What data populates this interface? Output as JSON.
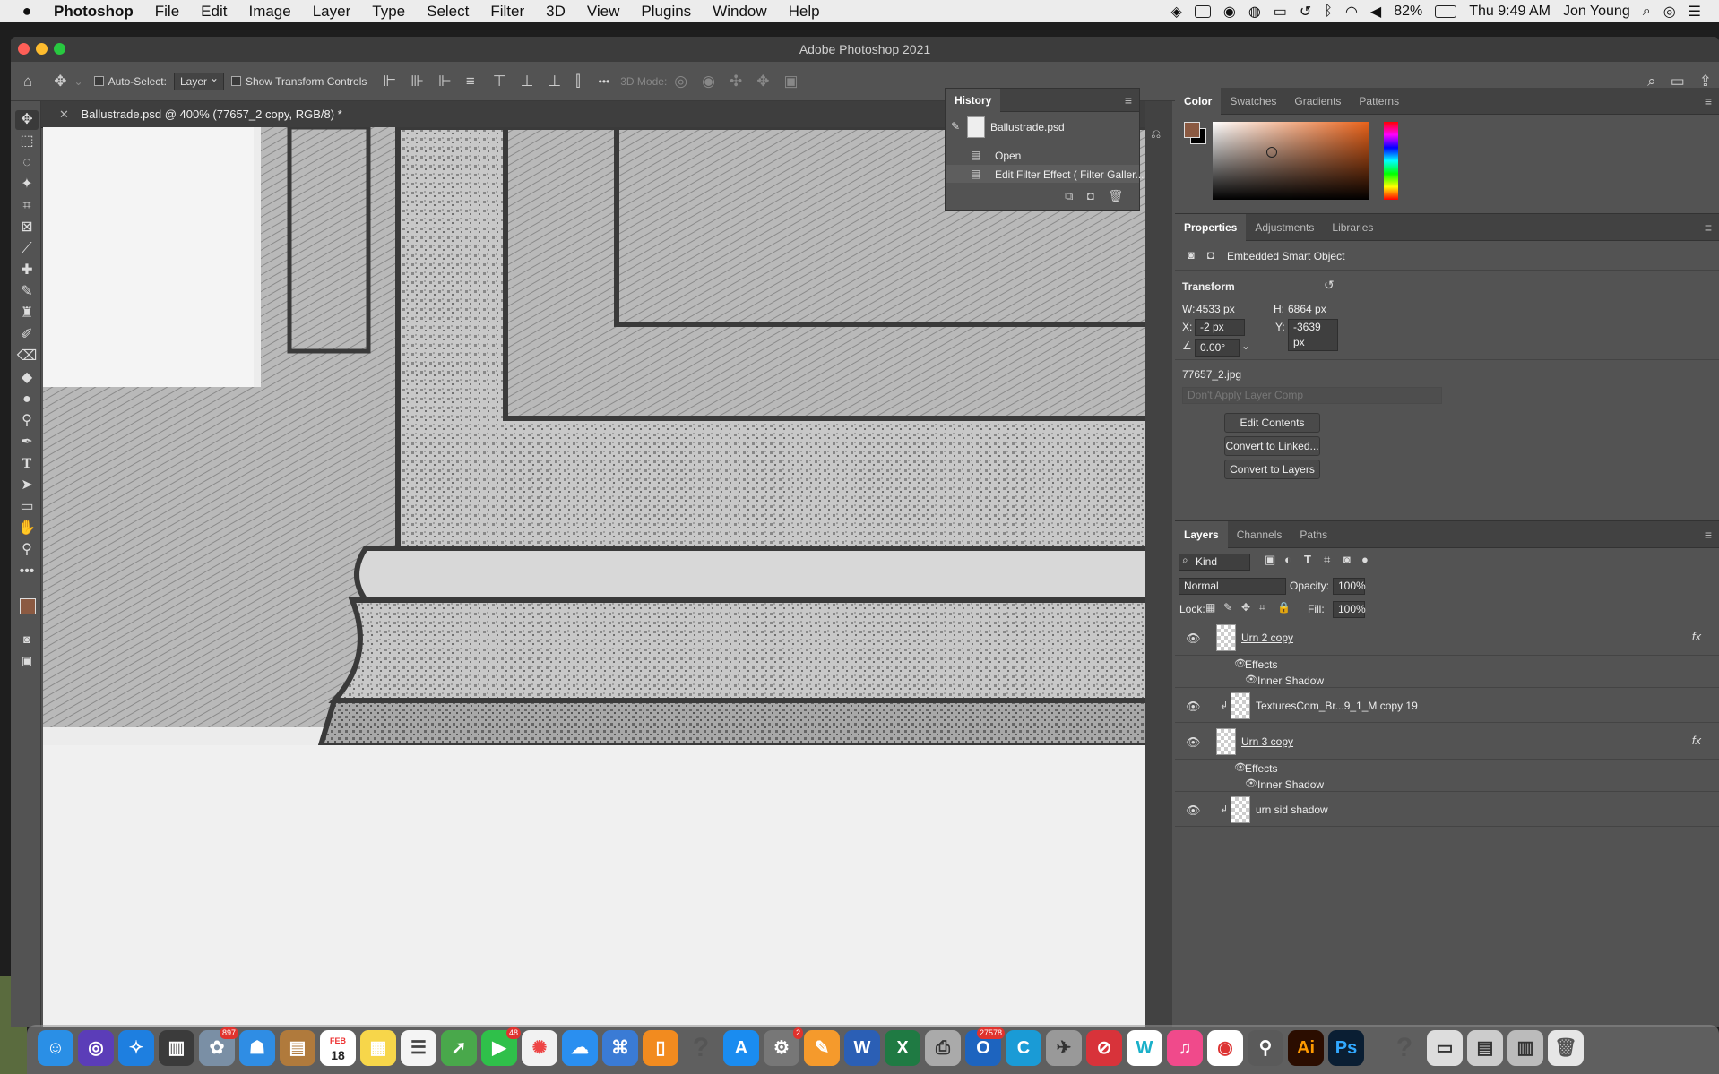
{
  "menubar": {
    "apple": "",
    "items": [
      "Photoshop",
      "File",
      "Edit",
      "Image",
      "Layer",
      "Type",
      "Select",
      "Filter",
      "3D",
      "View",
      "Plugins",
      "Window",
      "Help"
    ],
    "battery": "82%",
    "clock": "Thu 9:49 AM",
    "user": "Jon Young"
  },
  "window": {
    "title": "Adobe Photoshop 2021"
  },
  "options": {
    "auto_select_label": "Auto-Select:",
    "auto_select_value": "Layer",
    "show_transform_label": "Show Transform Controls",
    "mode_3d": "3D Mode:",
    "more": "•••"
  },
  "document": {
    "tab_title": "Ballustrade.psd @ 400% (77657_2 copy, RGB/8) *"
  },
  "history": {
    "title": "History",
    "snapshot": "Ballustrade.psd",
    "items": [
      "Open",
      "Edit Filter Effect ( Filter Galler..."
    ]
  },
  "color_panel": {
    "tabs": [
      "Color",
      "Swatches",
      "Gradients",
      "Patterns"
    ],
    "foreground": "#8b5a42",
    "hue": "#e8621a"
  },
  "properties": {
    "tabs": [
      "Properties",
      "Adjustments",
      "Libraries"
    ],
    "type": "Embedded Smart Object",
    "transform_label": "Transform",
    "w_label": "W:",
    "w": "4533 px",
    "h_label": "H:",
    "h": "6864 px",
    "x_label": "X:",
    "x": "-2 px",
    "y_label": "Y:",
    "y": "-3639 px",
    "angle": "0.00°",
    "filename": "77657_2.jpg",
    "layer_comp": "Don't Apply Layer Comp",
    "buttons": [
      "Edit Contents",
      "Convert to Linked...",
      "Convert to Layers"
    ]
  },
  "layers": {
    "tabs": [
      "Layers",
      "Channels",
      "Paths"
    ],
    "filter": "Kind",
    "blend": "Normal",
    "opacity_label": "Opacity:",
    "opacity": "100%",
    "lock_label": "Lock:",
    "fill_label": "Fill:",
    "fill": "100%",
    "rows": [
      {
        "name": "Urn 2 copy",
        "fx": "fx"
      },
      {
        "name": "Effects"
      },
      {
        "name": "Inner Shadow"
      },
      {
        "name": "TexturesCom_Br...9_1_M copy 19"
      },
      {
        "name": "Urn 3 copy",
        "fx": "fx"
      },
      {
        "name": "Effects"
      },
      {
        "name": "Inner Shadow"
      },
      {
        "name": "urn sid shadow"
      }
    ]
  },
  "dock": {
    "badge_photos": "897",
    "badge_calendar_month": "FEB",
    "badge_calendar_day": "18",
    "badge_facetime": "48",
    "badge_settings": "2",
    "badge_outlook": "27578"
  }
}
